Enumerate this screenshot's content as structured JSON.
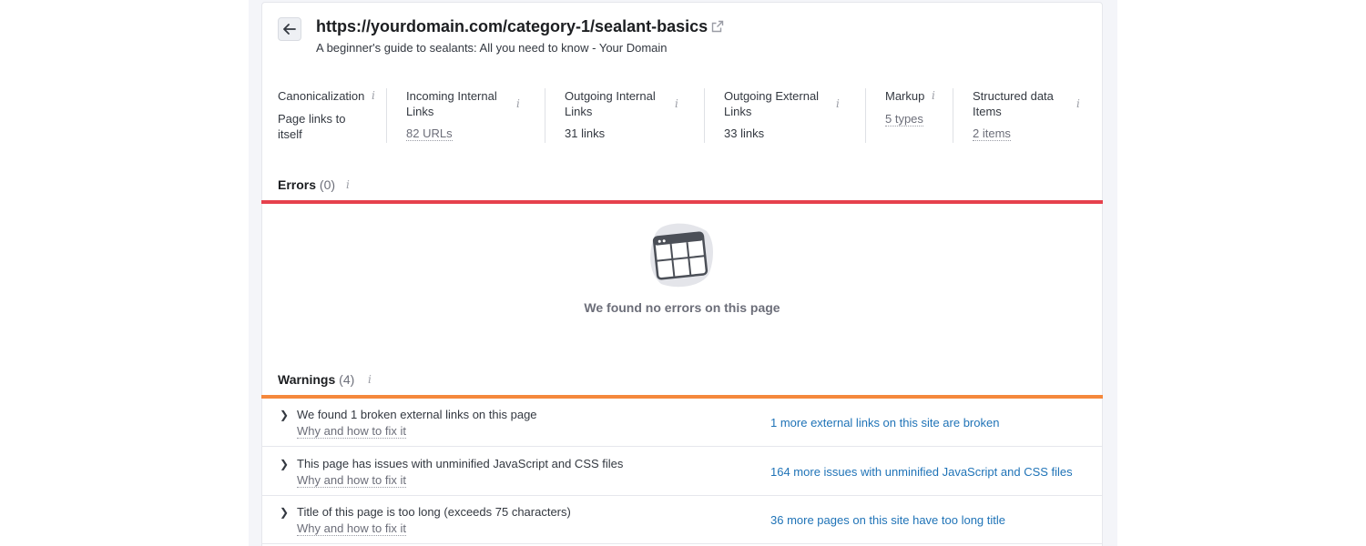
{
  "header": {
    "url": "https://yourdomain.com/category-1/sealant-basics",
    "subtitle": "A beginner's guide to sealants: All you need to know - Your Domain"
  },
  "metrics": [
    {
      "label_1": "Canonicalization",
      "label_2": "",
      "value_1": "Page links to",
      "value_2": "itself"
    },
    {
      "label_1": "Incoming Internal",
      "label_2": "Links",
      "value": "82 URLs"
    },
    {
      "label_1": "Outgoing Internal",
      "label_2": "Links",
      "value": "31 links"
    },
    {
      "label_1": "Outgoing External",
      "label_2": "Links",
      "value": "33 links"
    },
    {
      "label_1": "Markup",
      "value": "5 types"
    },
    {
      "label_1": "Structured data",
      "label_2": "Items",
      "value": "2 items"
    }
  ],
  "info_glyph": "i",
  "errors": {
    "title": "Errors",
    "count": "(0)",
    "empty_message": "We found no errors on this page",
    "bar_color": "#e6414d"
  },
  "warnings": {
    "title": "Warnings",
    "count": "(4)",
    "bar_color": "#f5883c",
    "items": [
      {
        "title": "We found 1 broken external links on this page",
        "fix": "Why and how to fix it",
        "more": "1 more external links on this site are broken"
      },
      {
        "title": "This page has issues with unminified JavaScript and CSS files",
        "fix": "Why and how to fix it",
        "more": "164 more issues with unminified JavaScript and CSS files"
      },
      {
        "title": "Title of this page is too long (exceeds 75 characters)",
        "fix": "Why and how to fix it",
        "more": "36 more pages on this site have too long title"
      }
    ]
  },
  "icons": {
    "back": "arrow-left-icon",
    "external": "external-link-icon",
    "expand": "chevron-right-icon",
    "empty_state": "empty-table-illustration"
  }
}
